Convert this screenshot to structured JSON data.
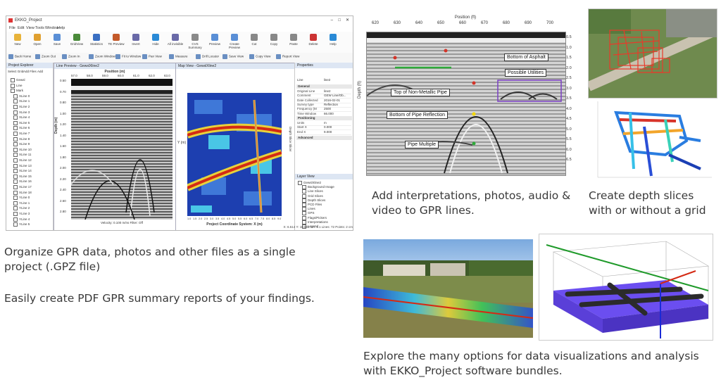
{
  "app": {
    "title": "EKKO_Project",
    "menus": [
      "File",
      "Edit",
      "View",
      "Tools",
      "Window",
      "Help"
    ],
    "ribbon": [
      "New",
      "Open",
      "Save",
      "GridView",
      "Statistics",
      "TE Preview",
      "Invert",
      "Hide",
      "All invisible",
      "CVS Summary",
      "Preview",
      "Create Preview",
      "Cut",
      "Copy",
      "Paste",
      "Delete",
      "Help"
    ],
    "toolbar": [
      "Back Home",
      "Zoom Out",
      "Zoom In",
      "Zoom Window",
      "Fit to Window",
      "Pan View",
      "Measure",
      "Drill Locator",
      "Save View",
      "Copy View",
      "Report View"
    ],
    "explorer_title": "Project Explorer",
    "explorer_actions": [
      "Select Grid",
      "Add Files",
      "Add"
    ],
    "tree": [
      "Gewsl",
      "Line",
      "Mark",
      "XLine 0",
      "XLine 1",
      "XLine 2",
      "XLine 3",
      "XLine 4",
      "XLine 5",
      "XLine 6",
      "XLine 7",
      "XLine 8",
      "XLine 9",
      "XLine 10",
      "XLine 11",
      "XLine 12",
      "XLine 13",
      "XLine 14",
      "XLine 15",
      "XLine 16",
      "XLine 17",
      "XLine 18",
      "YLine 0",
      "YLine 1",
      "YLine 2",
      "YLine 3",
      "YLine 4",
      "YLine 5"
    ],
    "line_view_title": "Line Preview - GewslXline2",
    "position_label": "Position (m)",
    "position_ticks": [
      "57.0",
      "58.0",
      "59.0",
      "60.0",
      "61.0",
      "62.0",
      "63.0"
    ],
    "depth_label": "Depth (m)",
    "depth_ticks": [
      "0.50",
      "0.70",
      "0.80",
      "1.00",
      "1.20",
      "1.40",
      "1.60",
      "1.80",
      "2.00",
      "2.20",
      "2.40",
      "2.60",
      "2.80"
    ],
    "line_status": "Velocity: 0.100 m/ns   Filter: Off",
    "map_view_title": "Map View - GewslXline2",
    "map_xlabel": "Project Coordinate System: X (m)",
    "map_xticks": [
      "1.0",
      "1.5",
      "2.0",
      "2.5",
      "3.0",
      "3.5",
      "4.0",
      "4.5",
      "5.0",
      "5.5",
      "6.0",
      "6.5",
      "7.0",
      "7.5",
      "8.0",
      "8.5",
      "9.0"
    ],
    "map_ylabel": "Y (m)",
    "map_side_label": "Depth Slice Slicer",
    "properties_title": "Properties",
    "properties_line": "Line",
    "properties_line_value": "line2",
    "properties_general": "General",
    "properties": [
      {
        "k": "Original Line",
        "v": "line2"
      },
      {
        "k": "Comment",
        "v": "GEW Line/Ob..."
      },
      {
        "k": "Date Collected",
        "v": "2016-02-01"
      },
      {
        "k": "Survey type",
        "v": "Reflection"
      },
      {
        "k": "Frequency (M",
        "v": "2500"
      },
      {
        "k": "Time Window",
        "v": "66.000"
      }
    ],
    "properties_positioning": "Positioning",
    "positioning": [
      {
        "k": "Units",
        "v": "m"
      },
      {
        "k": "Start X",
        "v": "0.000"
      },
      {
        "k": "End X",
        "v": "9.000"
      }
    ],
    "properties_advanced": "Advanced",
    "layer_title": "Layer View",
    "layers": [
      "GewslXline2",
      "Background Image",
      "Line Slices",
      "Grid Slices",
      "Depth Slices",
      "PCD Files",
      "Lines",
      "GPS",
      "Flags/Pickers",
      "Interpretations",
      "Legend"
    ],
    "status": "X: 6.514  Y: 10.661     cm: 1.1  Lines: 72   Points: 2 cm"
  },
  "gpr": {
    "xlabel": "Position (ft)",
    "xticks": [
      "620",
      "630",
      "640",
      "650",
      "660",
      "670",
      "680",
      "690",
      "700"
    ],
    "ylabel": "Depth (ft)",
    "yticks": [
      "0.5",
      "1.0",
      "1.5",
      "2.0",
      "2.5",
      "3.0",
      "3.5",
      "4.0",
      "4.5",
      "5.0",
      "5.5",
      "6.0",
      "6.5"
    ],
    "annotations": [
      "Bottom of Asphalt",
      "Possible Utilities",
      "Top of Non-Metallic Pipe",
      "Bottom of Pipe Reflection",
      "Pipe Multiple"
    ]
  },
  "captions": {
    "organize": "Organize GPR data, photos and other files as a single project (.GPZ file)",
    "reports": "Easily create PDF GPR summary reports of your findings.",
    "interpretations": "Add interpretations, photos, audio & video to GPR lines.",
    "depth_slices": "Create depth slices with or without a grid",
    "explore": "Explore the many options for data visualizations and analysis with EKKO_Project software bundles."
  }
}
